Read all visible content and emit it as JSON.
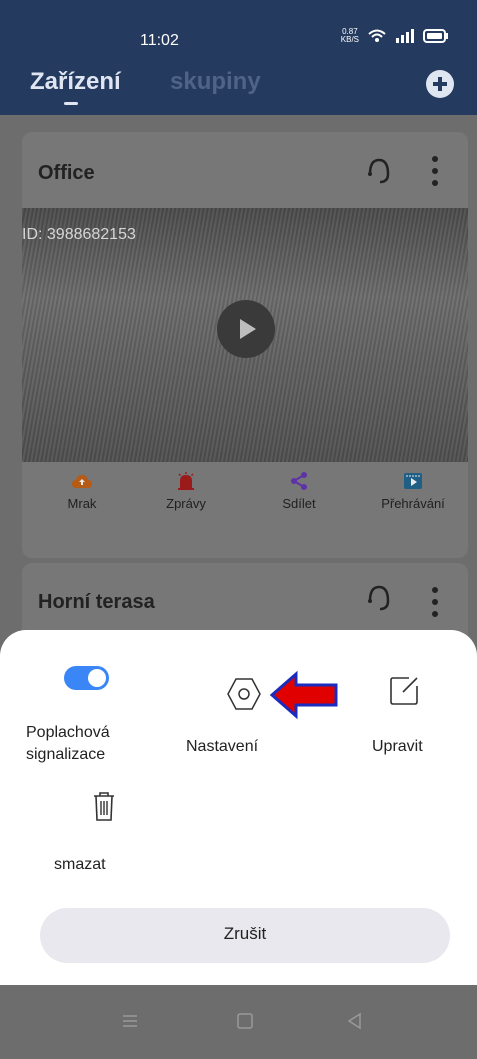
{
  "status": {
    "time": "11:02",
    "net_speed": "0.87",
    "net_unit": "KB/S"
  },
  "header": {
    "tabs": [
      {
        "label": "Zařízení",
        "active": true
      },
      {
        "label": "skupiny",
        "active": false
      }
    ]
  },
  "devices": [
    {
      "name": "Office",
      "stream_overlay_id": "ID: 3988682153",
      "actions": [
        {
          "label": "Mrak",
          "icon": "cloud-icon",
          "color": "#b55b16"
        },
        {
          "label": "Zprávy",
          "icon": "alarm-icon",
          "color": "#9b1b1b"
        },
        {
          "label": "Sdílet",
          "icon": "share-icon",
          "color": "#5d33a8"
        },
        {
          "label": "Přehrávání",
          "icon": "playback-icon",
          "color": "#1f5f86"
        }
      ]
    },
    {
      "name": "Horní terasa"
    }
  ],
  "sheet": {
    "items": [
      {
        "label_line1": "Poplachová",
        "label_line2": "signalizace",
        "icon": "toggle-on-icon"
      },
      {
        "label": "Nastavení",
        "icon": "settings-hex-icon"
      },
      {
        "label": "Upravit",
        "icon": "edit-icon"
      },
      {
        "label": "smazat",
        "icon": "trash-icon"
      }
    ],
    "cancel_label": "Zrušit"
  },
  "colors": {
    "header_bg": "#243a5e",
    "toggle_on": "#3a86f6",
    "arrow": "#e00000"
  }
}
